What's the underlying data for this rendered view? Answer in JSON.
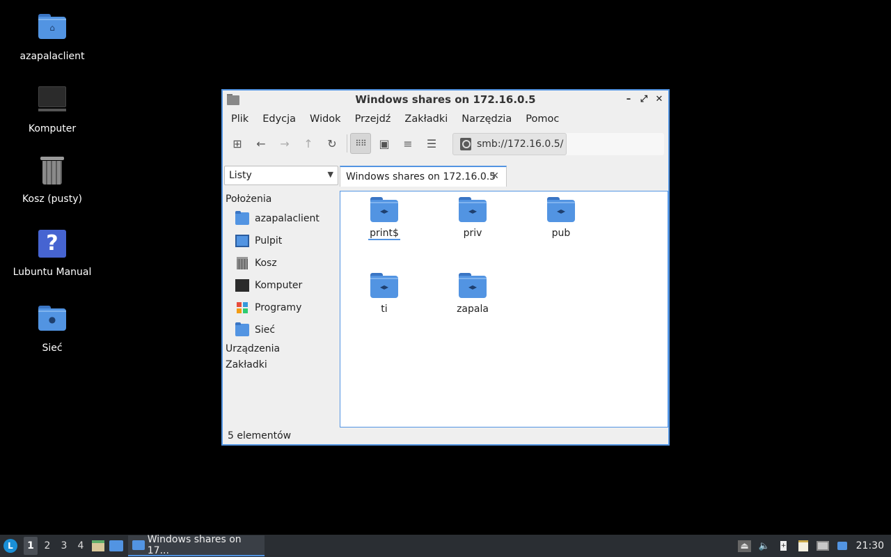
{
  "desktop": {
    "icons": [
      {
        "label": "azapalaclient",
        "icon": "home-folder-icon"
      },
      {
        "label": "Komputer",
        "icon": "computer-icon"
      },
      {
        "label": "Kosz (pusty)",
        "icon": "trash-icon"
      },
      {
        "label": "Lubuntu Manual",
        "icon": "help-icon"
      },
      {
        "label": "Sieć",
        "icon": "network-folder-icon"
      }
    ]
  },
  "window": {
    "title": "Windows shares on 172.16.0.5",
    "menu": [
      "Plik",
      "Edycja",
      "Widok",
      "Przejdź",
      "Zakładki",
      "Narzędzia",
      "Pomoc"
    ],
    "path": "smb://172.16.0.5/",
    "side_mode": "Listy",
    "sidebar": {
      "places_header": "Położenia",
      "places": [
        "azapalaclient",
        "Pulpit",
        "Kosz",
        "Komputer",
        "Programy",
        "Sieć"
      ],
      "devices_header": "Urządzenia",
      "bookmarks_header": "Zakładki"
    },
    "tab_label": "Windows shares on 172.16.0.5",
    "shares": [
      "print$",
      "priv",
      "pub",
      "ti",
      "zapala"
    ],
    "status": "5 elementów"
  },
  "taskbar": {
    "workspaces": [
      "1",
      "2",
      "3",
      "4"
    ],
    "active_workspace": "1",
    "task_label": "Windows shares on 17...",
    "clock": "21:30"
  },
  "colors": {
    "accent": "#5294e2",
    "taskbar": "#2a2e33",
    "window_bg": "#efefef"
  }
}
